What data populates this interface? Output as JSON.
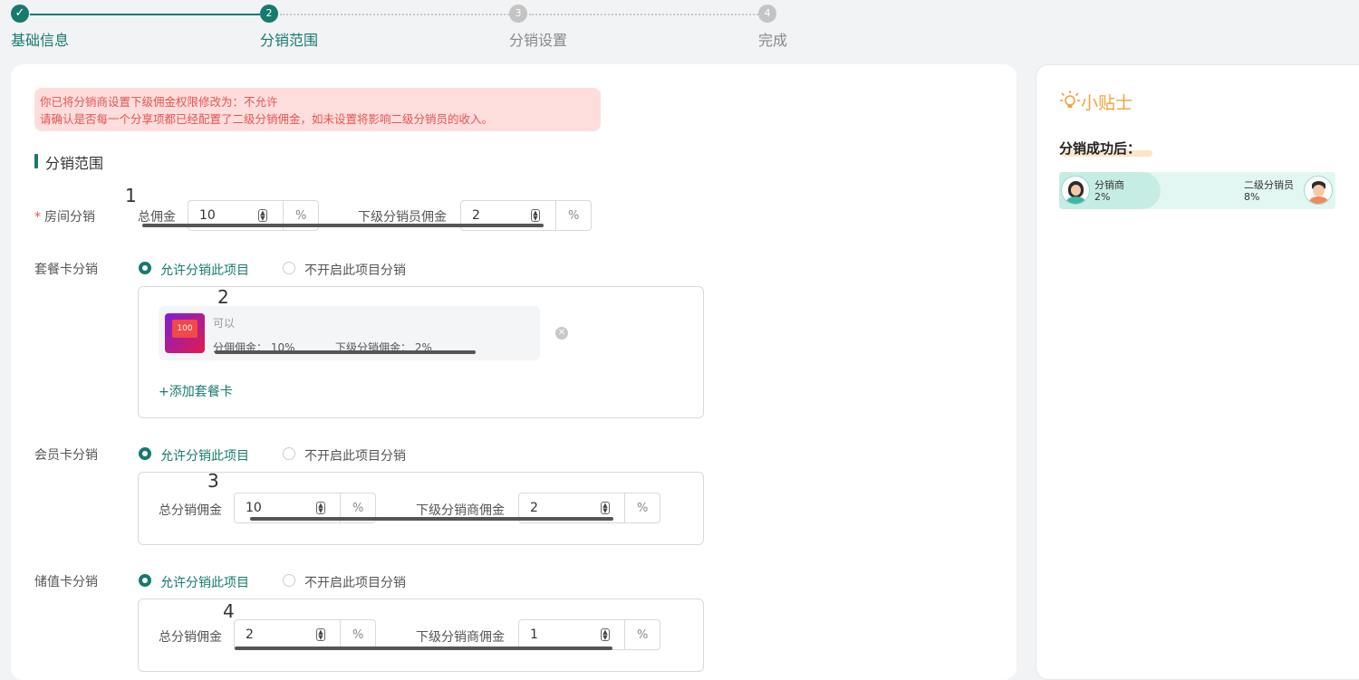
{
  "steps": [
    {
      "label": "基础信息",
      "num": "✓"
    },
    {
      "label": "分销范围",
      "num": "2"
    },
    {
      "label": "分销设置",
      "num": "3"
    },
    {
      "label": "完成",
      "num": "4"
    }
  ],
  "notice": {
    "line1": "你已将分销商设置下级佣金权限修改为：不允许",
    "line2": "请确认是否每一个分享项都已经配置了二级分销佣金，如未设置将影响二级分销员的收入。"
  },
  "section_title": "分销范围",
  "annotations": [
    "1",
    "2",
    "3",
    "4"
  ],
  "room": {
    "required_mark": "*",
    "label": "房间分销",
    "total_label": "总佣金",
    "total_value": "10",
    "sub_label": "下级分销员佣金",
    "sub_value": "2",
    "unit": "%"
  },
  "package": {
    "label": "套餐卡分销",
    "allow_label": "允许分销此项目",
    "deny_label": "不开启此项目分销",
    "item_name": "可以",
    "item_thumb_text": "100",
    "item_commission": "分佣佣金： 10%",
    "item_sub_commission": "下级分销佣金： 2%",
    "add_label": "+添加套餐卡"
  },
  "member": {
    "label": "会员卡分销",
    "allow_label": "允许分销此项目",
    "deny_label": "不开启此项目分销",
    "total_label": "总分销佣金",
    "total_value": "10",
    "sub_label": "下级分销商佣金",
    "sub_value": "2",
    "unit": "%"
  },
  "stored": {
    "label": "储值卡分销",
    "allow_label": "允许分销此项目",
    "deny_label": "不开启此项目分销",
    "total_label": "总分销佣金",
    "total_value": "2",
    "sub_label": "下级分销商佣金",
    "sub_value": "1",
    "unit": "%"
  },
  "tips": {
    "title": "小贴士",
    "subtitle": "分销成功后：",
    "left_name": "分销商",
    "left_pct": "2%",
    "right_name": "二级分销员",
    "right_pct": "8%"
  },
  "colors": {
    "brand": "#167a6e",
    "warning_bg": "#fddedd",
    "warning_text": "#e4554f",
    "tip_orange": "#f0a23b",
    "tip_bar": "#d6f3ec"
  },
  "icons": [
    "check-icon",
    "spinner-icon",
    "close-circle-icon",
    "lightbulb-icon",
    "avatar-icon"
  ]
}
